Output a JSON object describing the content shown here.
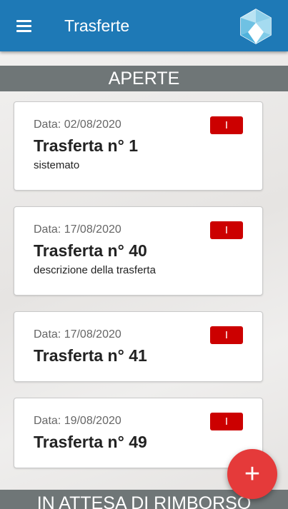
{
  "app_bar": {
    "title": "Trasferte",
    "menu_icon": "hamburger-menu-icon",
    "logo_icon": "crystal-logo-icon",
    "color": "#1e79b6"
  },
  "sections": {
    "open": {
      "label": "APERTE"
    },
    "waiting": {
      "label": "IN ATTESA DI RIMBORSO"
    }
  },
  "cards": [
    {
      "date": "Data: 02/08/2020",
      "title": "Trasferta n° 1",
      "description": "sistemato",
      "badge": "I"
    },
    {
      "date": "Data: 17/08/2020",
      "title": "Trasferta n° 40",
      "description": "descrizione della trasferta",
      "badge": "I"
    },
    {
      "date": "Data: 17/08/2020",
      "title": "Trasferta n° 41",
      "description": "",
      "badge": "I"
    },
    {
      "date": "Data: 19/08/2020",
      "title": "Trasferta n° 49",
      "description": "",
      "badge": "I"
    }
  ],
  "fab": {
    "label": "+",
    "icon": "plus-icon",
    "color": "#e53a3a"
  },
  "colors": {
    "badge": "#cc0000",
    "section_header": "#6f7677"
  }
}
